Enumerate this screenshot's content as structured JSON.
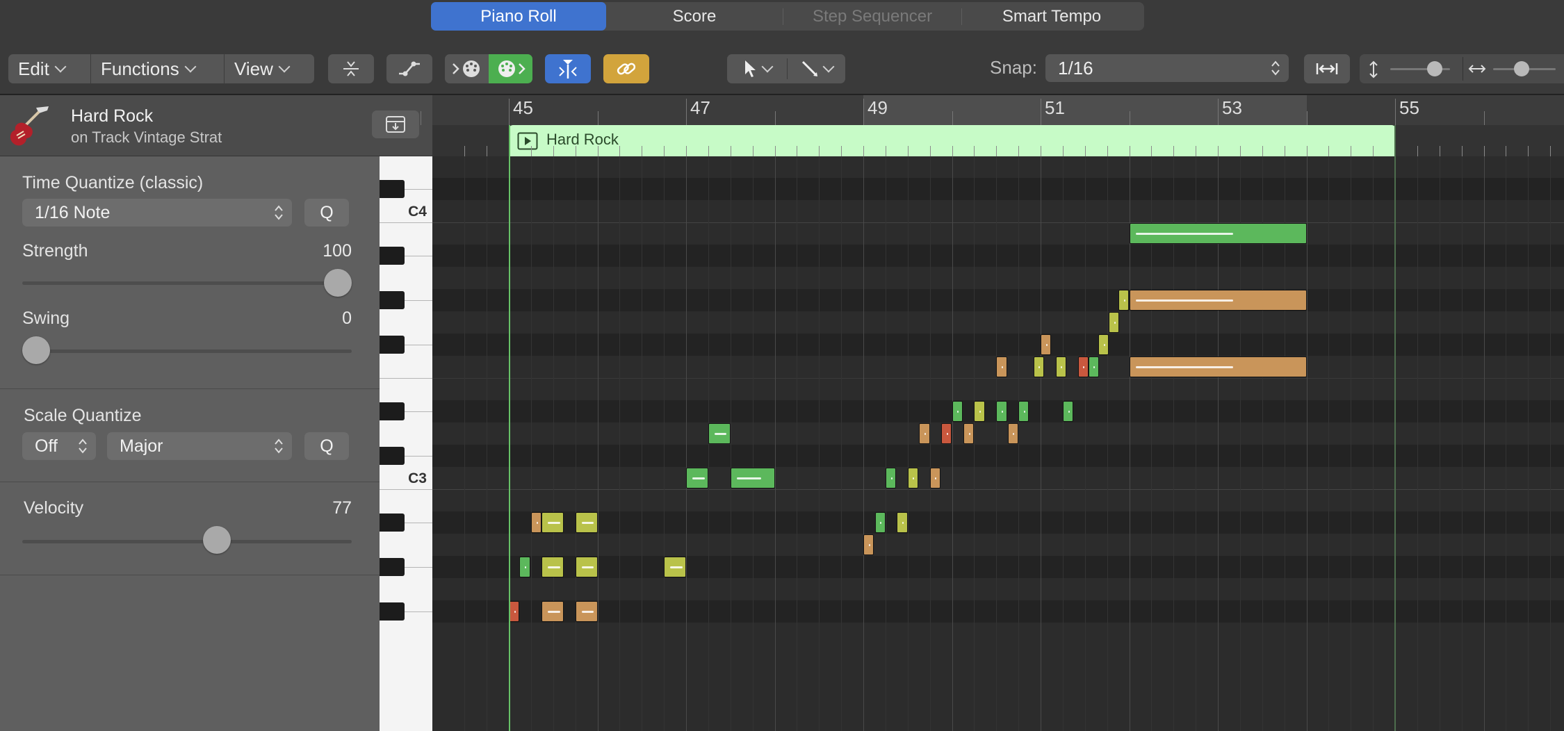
{
  "tabs": [
    {
      "label": "Piano Roll",
      "state": "active"
    },
    {
      "label": "Score",
      "state": "normal"
    },
    {
      "label": "Step Sequencer",
      "state": "disabled"
    },
    {
      "label": "Smart Tempo",
      "state": "normal"
    }
  ],
  "toolbar": {
    "edit_label": "Edit",
    "functions_label": "Functions",
    "view_label": "View",
    "snap_label": "Snap:",
    "snap_value": "1/16"
  },
  "colors": {
    "accent_blue": "#3f73cf",
    "link_yellow": "#d2a43c",
    "region_green": "#c7fbc7",
    "note_green": "#5cb85c",
    "note_yellow": "#b9c24a",
    "note_orange": "#c9955a",
    "note_red": "#c9583e"
  },
  "region": {
    "name": "Hard Rock",
    "track": "on Track Vintage Strat",
    "strip_name": "Hard Rock"
  },
  "inspector": {
    "time_quantize_label": "Time Quantize (classic)",
    "time_quantize_value": "1/16 Note",
    "q_label": "Q",
    "strength_label": "Strength",
    "strength_value": "100",
    "strength_level": 1.0,
    "swing_label": "Swing",
    "swing_value": "0",
    "swing_level": 0.0,
    "scale_quantize_label": "Scale Quantize",
    "scale_off_value": "Off",
    "scale_value": "Major",
    "q2_label": "Q",
    "velocity_label": "Velocity",
    "velocity_value": "77",
    "velocity_level": 0.6
  },
  "keyboard": {
    "labels": [
      "C4",
      "C3"
    ]
  },
  "ruler": {
    "bars": [
      "45",
      "47",
      "49",
      "51",
      "53",
      "55"
    ],
    "cycle_range_bars": [
      49,
      54
    ]
  },
  "notes": [
    {
      "bar": 52.0,
      "len": 2.0,
      "pitch": "B3",
      "color": "green"
    },
    {
      "bar": 51.88,
      "len": 0.12,
      "pitch": "G#3",
      "color": "yellow"
    },
    {
      "bar": 52.0,
      "len": 2.0,
      "pitch": "G#3",
      "color": "orange"
    },
    {
      "bar": 51.77,
      "len": 0.12,
      "pitch": "G3",
      "color": "yellow"
    },
    {
      "bar": 51.0,
      "len": 0.12,
      "pitch": "F#3",
      "color": "orange"
    },
    {
      "bar": 51.65,
      "len": 0.12,
      "pitch": "F#3",
      "color": "yellow"
    },
    {
      "bar": 50.5,
      "len": 0.12,
      "pitch": "F3",
      "color": "orange"
    },
    {
      "bar": 50.92,
      "len": 0.12,
      "pitch": "F3",
      "color": "yellow"
    },
    {
      "bar": 51.17,
      "len": 0.12,
      "pitch": "F3",
      "color": "yellow"
    },
    {
      "bar": 51.42,
      "len": 0.12,
      "pitch": "F3",
      "color": "red"
    },
    {
      "bar": 51.54,
      "len": 0.12,
      "pitch": "F3",
      "color": "green"
    },
    {
      "bar": 52.0,
      "len": 2.0,
      "pitch": "F3",
      "color": "orange"
    },
    {
      "bar": 50.0,
      "len": 0.12,
      "pitch": "D#3",
      "color": "green"
    },
    {
      "bar": 50.25,
      "len": 0.12,
      "pitch": "D#3",
      "color": "yellow"
    },
    {
      "bar": 50.5,
      "len": 0.12,
      "pitch": "D#3",
      "color": "green"
    },
    {
      "bar": 50.75,
      "len": 0.12,
      "pitch": "D#3",
      "color": "green"
    },
    {
      "bar": 51.25,
      "len": 0.12,
      "pitch": "D#3",
      "color": "green"
    },
    {
      "bar": 47.25,
      "len": 0.25,
      "pitch": "D3",
      "color": "green"
    },
    {
      "bar": 49.63,
      "len": 0.12,
      "pitch": "D3",
      "color": "orange"
    },
    {
      "bar": 49.88,
      "len": 0.12,
      "pitch": "D3",
      "color": "red"
    },
    {
      "bar": 50.13,
      "len": 0.12,
      "pitch": "D3",
      "color": "orange"
    },
    {
      "bar": 50.63,
      "len": 0.12,
      "pitch": "D3",
      "color": "orange"
    },
    {
      "bar": 47.0,
      "len": 0.25,
      "pitch": "C3",
      "color": "green"
    },
    {
      "bar": 47.5,
      "len": 0.5,
      "pitch": "C3",
      "color": "green"
    },
    {
      "bar": 49.25,
      "len": 0.12,
      "pitch": "C3",
      "color": "green"
    },
    {
      "bar": 49.5,
      "len": 0.12,
      "pitch": "C3",
      "color": "yellow"
    },
    {
      "bar": 49.75,
      "len": 0.12,
      "pitch": "C3",
      "color": "orange"
    },
    {
      "bar": 45.25,
      "len": 0.12,
      "pitch": "A#2",
      "color": "orange"
    },
    {
      "bar": 45.37,
      "len": 0.25,
      "pitch": "A#2",
      "color": "yellow"
    },
    {
      "bar": 45.75,
      "len": 0.25,
      "pitch": "A#2",
      "color": "yellow"
    },
    {
      "bar": 49.13,
      "len": 0.12,
      "pitch": "A#2",
      "color": "green"
    },
    {
      "bar": 49.38,
      "len": 0.12,
      "pitch": "A#2",
      "color": "yellow"
    },
    {
      "bar": 49.0,
      "len": 0.12,
      "pitch": "A2",
      "color": "orange"
    },
    {
      "bar": 45.12,
      "len": 0.12,
      "pitch": "G#2",
      "color": "green"
    },
    {
      "bar": 45.37,
      "len": 0.25,
      "pitch": "G#2",
      "color": "yellow"
    },
    {
      "bar": 45.75,
      "len": 0.25,
      "pitch": "G#2",
      "color": "yellow"
    },
    {
      "bar": 46.75,
      "len": 0.25,
      "pitch": "G#2",
      "color": "yellow"
    },
    {
      "bar": 45.0,
      "len": 0.12,
      "pitch": "F#2",
      "color": "red"
    },
    {
      "bar": 45.37,
      "len": 0.25,
      "pitch": "F#2",
      "color": "orange"
    },
    {
      "bar": 45.75,
      "len": 0.25,
      "pitch": "F#2",
      "color": "orange"
    }
  ]
}
